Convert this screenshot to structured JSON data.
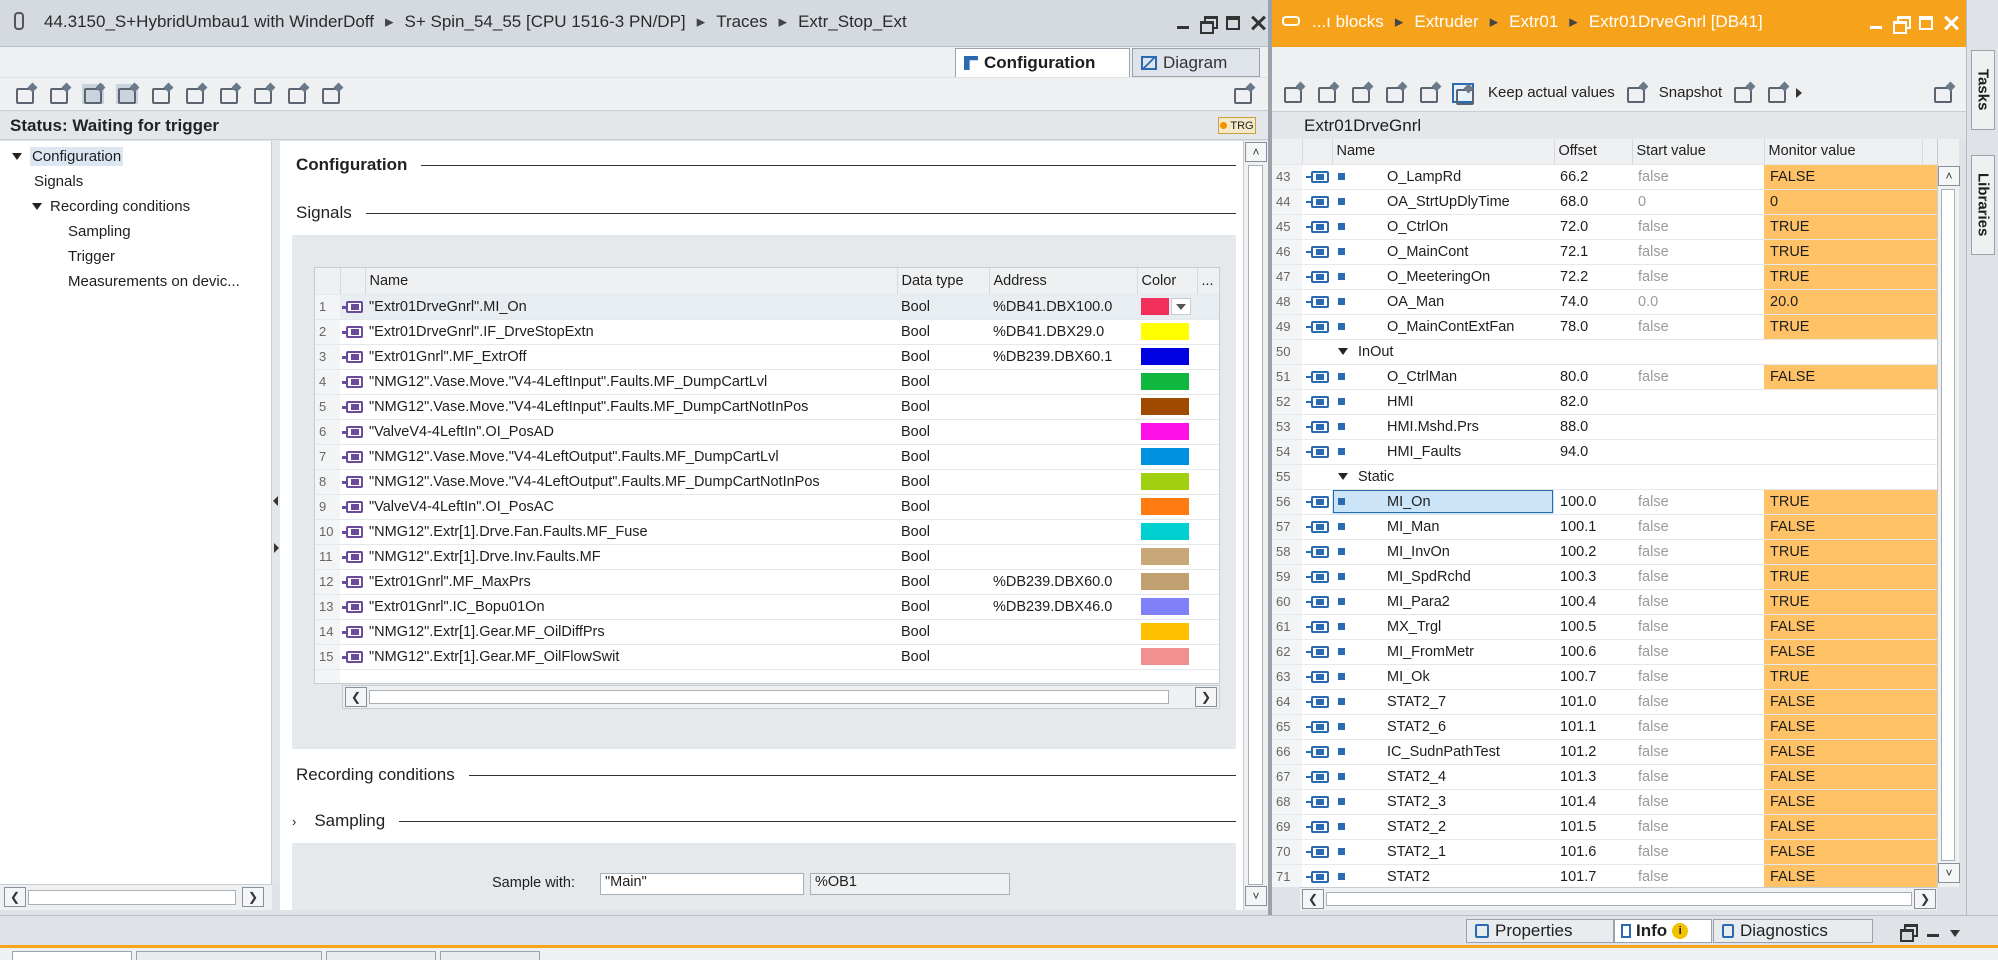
{
  "left_window": {
    "breadcrumb": [
      "44.3150_S+HybridUmbau1 with WinderDoff",
      "S+ Spin_54_55 [CPU 1516-3 PN/DP]",
      "Traces",
      "Extr_Stop_Ext"
    ],
    "tabs": {
      "configuration": "Configuration",
      "diagram": "Diagram"
    },
    "status": "Status: Waiting for trigger",
    "trg_badge": "TRG"
  },
  "tree": {
    "items": [
      {
        "label": "Configuration",
        "level": 0,
        "expanded": true,
        "selected": true
      },
      {
        "label": "Signals",
        "level": 1
      },
      {
        "label": "Recording conditions",
        "level": 1,
        "expanded": true
      },
      {
        "label": "Sampling",
        "level": 2
      },
      {
        "label": "Trigger",
        "level": 2
      },
      {
        "label": "Measurements on devic...",
        "level": 2
      }
    ]
  },
  "config": {
    "section_configuration": "Configuration",
    "section_signals": "Signals",
    "section_recording": "Recording conditions",
    "section_sampling": "Sampling",
    "sample_with_label": "Sample with:",
    "sample_with_value": "\"Main\"",
    "sample_with_ob": "%OB1"
  },
  "signals_table": {
    "headers": [
      "Name",
      "Data type",
      "Address",
      "Color",
      "..."
    ],
    "rows": [
      {
        "n": "1",
        "name": "\"Extr01DrveGnrl\".MI_On",
        "type": "Bool",
        "addr": "%DB41.DBX100.0",
        "color": "#f0305a"
      },
      {
        "n": "2",
        "name": "\"Extr01DrveGnrl\".IF_DrveStopExtn",
        "type": "Bool",
        "addr": "%DB41.DBX29.0",
        "color": "#ffff00"
      },
      {
        "n": "3",
        "name": "\"Extr01Gnrl\".MF_ExtrOff",
        "type": "Bool",
        "addr": "%DB239.DBX60.1",
        "color": "#0000e0"
      },
      {
        "n": "4",
        "name": "\"NMG12\".Vase.Move.\"V4-4LeftInput\".Faults.MF_DumpCartLvl",
        "type": "Bool",
        "addr": "",
        "color": "#10b840"
      },
      {
        "n": "5",
        "name": "\"NMG12\".Vase.Move.\"V4-4LeftInput\".Faults.MF_DumpCartNotInPos",
        "type": "Bool",
        "addr": "",
        "color": "#a04a00"
      },
      {
        "n": "6",
        "name": "\"ValveV4-4LeftIn\".OI_PosAD",
        "type": "Bool",
        "addr": "",
        "color": "#ff10e8"
      },
      {
        "n": "7",
        "name": "\"NMG12\".Vase.Move.\"V4-4LeftOutput\".Faults.MF_DumpCartLvl",
        "type": "Bool",
        "addr": "",
        "color": "#0090e0"
      },
      {
        "n": "8",
        "name": "\"NMG12\".Vase.Move.\"V4-4LeftOutput\".Faults.MF_DumpCartNotInPos",
        "type": "Bool",
        "addr": "",
        "color": "#a0d010"
      },
      {
        "n": "9",
        "name": "\"ValveV4-4LeftIn\".OI_PosAC",
        "type": "Bool",
        "addr": "",
        "color": "#ff7a10"
      },
      {
        "n": "10",
        "name": "\"NMG12\".Extr[1].Drve.Fan.Faults.MF_Fuse",
        "type": "Bool",
        "addr": "",
        "color": "#00d0d0"
      },
      {
        "n": "11",
        "name": "\"NMG12\".Extr[1].Drve.Inv.Faults.MF",
        "type": "Bool",
        "addr": "",
        "color": "#c8a878"
      },
      {
        "n": "12",
        "name": "\"Extr01Gnrl\".MF_MaxPrs",
        "type": "Bool",
        "addr": "%DB239.DBX60.0",
        "color": "#c0a070"
      },
      {
        "n": "13",
        "name": "\"Extr01Gnrl\".IC_Bopu01On",
        "type": "Bool",
        "addr": "%DB239.DBX46.0",
        "color": "#8080f8"
      },
      {
        "n": "14",
        "name": "\"NMG12\".Extr[1].Gear.MF_OilDiffPrs",
        "type": "Bool",
        "addr": "",
        "color": "#ffc000"
      },
      {
        "n": "15",
        "name": "\"NMG12\".Extr[1].Gear.MF_OilFlowSwit",
        "type": "Bool",
        "addr": "",
        "color": "#f09090"
      }
    ]
  },
  "right_window": {
    "breadcrumb": [
      "...ı blocks",
      "Extruder",
      "Extr01",
      "Extr01DrveGnrl [DB41]"
    ],
    "keep_actual_values": "Keep actual values",
    "snapshot": "Snapshot",
    "block_title": "Extr01DrveGnrl",
    "headers": [
      "Name",
      "Offset",
      "Start value",
      "Monitor value"
    ]
  },
  "db_table": {
    "rows": [
      {
        "n": "43",
        "name": "O_LampRd",
        "offset": "66.2",
        "start": "false",
        "monitor": "FALSE",
        "indent": 2,
        "kind": "var"
      },
      {
        "n": "44",
        "name": "OA_StrtUpDlyTime",
        "offset": "68.0",
        "start": "0",
        "monitor": "0",
        "indent": 2,
        "kind": "var"
      },
      {
        "n": "45",
        "name": "O_CtrlOn",
        "offset": "72.0",
        "start": "false",
        "monitor": "TRUE",
        "indent": 2,
        "kind": "var"
      },
      {
        "n": "46",
        "name": "O_MainCont",
        "offset": "72.1",
        "start": "false",
        "monitor": "TRUE",
        "indent": 2,
        "kind": "var"
      },
      {
        "n": "47",
        "name": "O_MeeteringOn",
        "offset": "72.2",
        "start": "false",
        "monitor": "TRUE",
        "indent": 2,
        "kind": "var"
      },
      {
        "n": "48",
        "name": "OA_Man",
        "offset": "74.0",
        "start": "0.0",
        "monitor": "20.0",
        "indent": 2,
        "kind": "var"
      },
      {
        "n": "49",
        "name": "O_MainContExtFan",
        "offset": "78.0",
        "start": "false",
        "monitor": "TRUE",
        "indent": 2,
        "kind": "var"
      },
      {
        "n": "50",
        "name": "InOut",
        "offset": "",
        "start": "",
        "monitor": "",
        "indent": 1,
        "kind": "group"
      },
      {
        "n": "51",
        "name": "O_CtrlMan",
        "offset": "80.0",
        "start": "false",
        "monitor": "FALSE",
        "indent": 2,
        "kind": "var"
      },
      {
        "n": "52",
        "name": "HMI",
        "offset": "82.0",
        "start": "",
        "monitor": "",
        "indent": 2,
        "kind": "struct"
      },
      {
        "n": "53",
        "name": "HMI.Mshd.Prs",
        "offset": "88.0",
        "start": "",
        "monitor": "",
        "indent": 2,
        "kind": "struct"
      },
      {
        "n": "54",
        "name": "HMI_Faults",
        "offset": "94.0",
        "start": "",
        "monitor": "",
        "indent": 2,
        "kind": "struct"
      },
      {
        "n": "55",
        "name": "Static",
        "offset": "",
        "start": "",
        "monitor": "",
        "indent": 1,
        "kind": "group"
      },
      {
        "n": "56",
        "name": "MI_On",
        "offset": "100.0",
        "start": "false",
        "monitor": "TRUE",
        "indent": 2,
        "kind": "var",
        "selected": true
      },
      {
        "n": "57",
        "name": "MI_Man",
        "offset": "100.1",
        "start": "false",
        "monitor": "FALSE",
        "indent": 2,
        "kind": "var"
      },
      {
        "n": "58",
        "name": "MI_InvOn",
        "offset": "100.2",
        "start": "false",
        "monitor": "TRUE",
        "indent": 2,
        "kind": "var"
      },
      {
        "n": "59",
        "name": "MI_SpdRchd",
        "offset": "100.3",
        "start": "false",
        "monitor": "TRUE",
        "indent": 2,
        "kind": "var"
      },
      {
        "n": "60",
        "name": "MI_Para2",
        "offset": "100.4",
        "start": "false",
        "monitor": "TRUE",
        "indent": 2,
        "kind": "var"
      },
      {
        "n": "61",
        "name": "MX_Trgl",
        "offset": "100.5",
        "start": "false",
        "monitor": "FALSE",
        "indent": 2,
        "kind": "var"
      },
      {
        "n": "62",
        "name": "MI_FromMetr",
        "offset": "100.6",
        "start": "false",
        "monitor": "FALSE",
        "indent": 2,
        "kind": "var"
      },
      {
        "n": "63",
        "name": "MI_Ok",
        "offset": "100.7",
        "start": "false",
        "monitor": "TRUE",
        "indent": 2,
        "kind": "var"
      },
      {
        "n": "64",
        "name": "STAT2_7",
        "offset": "101.0",
        "start": "false",
        "monitor": "FALSE",
        "indent": 2,
        "kind": "var"
      },
      {
        "n": "65",
        "name": "STAT2_6",
        "offset": "101.1",
        "start": "false",
        "monitor": "FALSE",
        "indent": 2,
        "kind": "var"
      },
      {
        "n": "66",
        "name": "IC_SudnPathTest",
        "offset": "101.2",
        "start": "false",
        "monitor": "FALSE",
        "indent": 2,
        "kind": "var"
      },
      {
        "n": "67",
        "name": "STAT2_4",
        "offset": "101.3",
        "start": "false",
        "monitor": "FALSE",
        "indent": 2,
        "kind": "var"
      },
      {
        "n": "68",
        "name": "STAT2_3",
        "offset": "101.4",
        "start": "false",
        "monitor": "FALSE",
        "indent": 2,
        "kind": "var"
      },
      {
        "n": "69",
        "name": "STAT2_2",
        "offset": "101.5",
        "start": "false",
        "monitor": "FALSE",
        "indent": 2,
        "kind": "var"
      },
      {
        "n": "70",
        "name": "STAT2_1",
        "offset": "101.6",
        "start": "false",
        "monitor": "FALSE",
        "indent": 2,
        "kind": "var"
      },
      {
        "n": "71",
        "name": "STAT2",
        "offset": "101.7",
        "start": "false",
        "monitor": "FALSE",
        "indent": 2,
        "kind": "var"
      }
    ]
  },
  "side_tabs": {
    "tasks": "Tasks",
    "libraries": "Libraries"
  },
  "inspector": {
    "properties": "Properties",
    "info": "Info",
    "diagnostics": "Diagnostics"
  },
  "colors": {
    "accent_orange": "#f7a21b",
    "monitor_bg": "#ffc266",
    "selection_blue": "#cce4f7"
  }
}
